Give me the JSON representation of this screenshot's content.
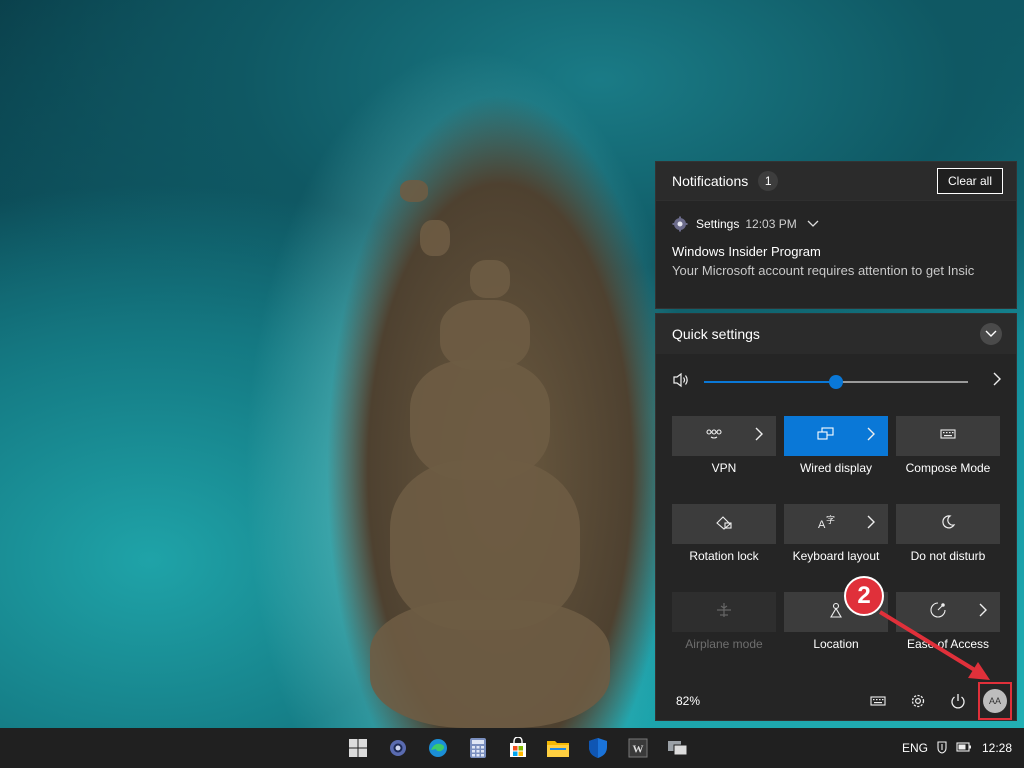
{
  "notifications": {
    "title": "Notifications",
    "count": "1",
    "clear_all_label": "Clear all",
    "item": {
      "app": "Settings",
      "time": "12:03 PM",
      "headline": "Windows Insider Program",
      "body": "Your Microsoft account requires attention to get Insic"
    }
  },
  "quick_settings": {
    "title": "Quick settings",
    "volume_fraction": 0.5,
    "tiles": [
      {
        "label": "VPN",
        "icon": "vpn-icon",
        "active": false,
        "disabled": false,
        "has_chevron": true
      },
      {
        "label": "Wired display",
        "icon": "project-icon",
        "active": true,
        "disabled": false,
        "has_chevron": true
      },
      {
        "label": "Compose Mode",
        "icon": "keyboard-icon",
        "active": false,
        "disabled": false,
        "has_chevron": false
      },
      {
        "label": "Rotation lock",
        "icon": "rotation-lock-icon",
        "active": false,
        "disabled": false,
        "has_chevron": false
      },
      {
        "label": "Keyboard layout",
        "icon": "keyboard-layout-icon",
        "active": false,
        "disabled": false,
        "has_chevron": true
      },
      {
        "label": "Do not disturb",
        "icon": "moon-icon",
        "active": false,
        "disabled": false,
        "has_chevron": false
      },
      {
        "label": "Airplane mode",
        "icon": "airplane-icon",
        "active": false,
        "disabled": true,
        "has_chevron": false
      },
      {
        "label": "Location",
        "icon": "location-icon",
        "active": false,
        "disabled": false,
        "has_chevron": false
      },
      {
        "label": "Ease of Access",
        "icon": "accessibility-icon",
        "active": false,
        "disabled": false,
        "has_chevron": true
      }
    ],
    "battery": "82%",
    "avatar_initials": "AA"
  },
  "annotation": {
    "step": "2",
    "color": "#e0303a"
  },
  "taskbar": {
    "apps": [
      "windows-start-icon",
      "settings-gear-icon",
      "edge-icon",
      "calculator-icon",
      "store-icon",
      "file-explorer-icon",
      "security-shield-icon",
      "word-icon",
      "task-view-icon"
    ],
    "language": "ENG",
    "time": "12:28"
  },
  "colors": {
    "accent": "#0a78d7",
    "panel": "#252525",
    "tile": "#3c3c3c"
  }
}
